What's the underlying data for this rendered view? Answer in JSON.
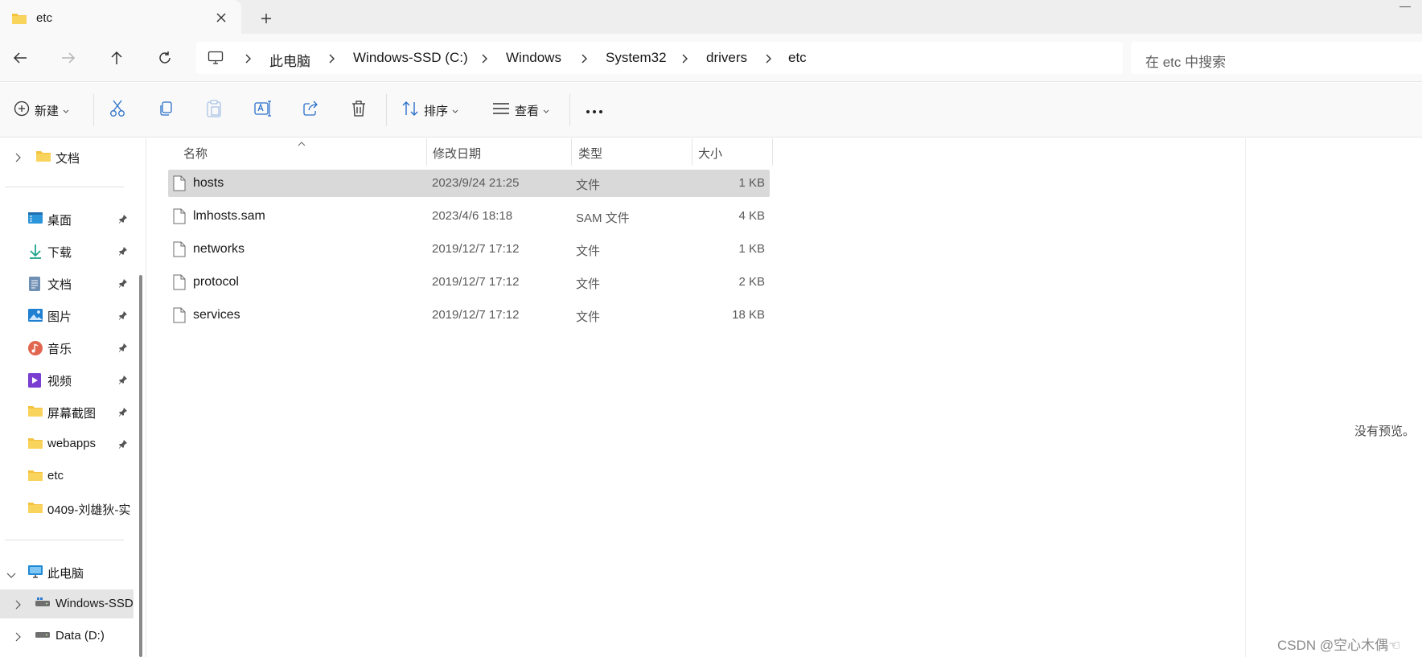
{
  "window": {
    "tab_title": "etc",
    "new_tab_symbol": "+"
  },
  "breadcrumb": [
    "此电脑",
    "Windows-SSD (C:)",
    "Windows",
    "System32",
    "drivers",
    "etc"
  ],
  "search": {
    "placeholder": "在 etc 中搜索"
  },
  "toolbar": {
    "new_label": "新建",
    "sort_label": "排序",
    "view_label": "查看",
    "more_label": "···"
  },
  "sidebar": {
    "top_item": {
      "label": "文档",
      "icon": "folder-icon"
    },
    "quick_access": [
      {
        "label": "桌面",
        "icon": "desktop-icon",
        "pinned": true
      },
      {
        "label": "下载",
        "icon": "download-icon",
        "pinned": true
      },
      {
        "label": "文档",
        "icon": "document-icon",
        "pinned": true
      },
      {
        "label": "图片",
        "icon": "pictures-icon",
        "pinned": true
      },
      {
        "label": "音乐",
        "icon": "music-icon",
        "pinned": true
      },
      {
        "label": "视频",
        "icon": "video-icon",
        "pinned": true
      },
      {
        "label": "屏幕截图",
        "icon": "folder-icon",
        "pinned": true
      },
      {
        "label": "webapps",
        "icon": "folder-icon",
        "pinned": true
      },
      {
        "label": "etc",
        "icon": "folder-icon",
        "pinned": false
      },
      {
        "label": "0409-刘雄狄-实",
        "icon": "folder-icon",
        "pinned": false
      }
    ],
    "this_pc": {
      "label": "此电脑",
      "icon": "computer-icon"
    },
    "drives": [
      {
        "label": "Windows-SSD",
        "icon": "drive-icon",
        "selected": true
      },
      {
        "label": "Data (D:)",
        "icon": "drive-icon",
        "selected": false
      }
    ]
  },
  "columns": {
    "name": "名称",
    "date": "修改日期",
    "type": "类型",
    "size": "大小"
  },
  "files": [
    {
      "name": "hosts",
      "date": "2023/9/24 21:25",
      "type": "文件",
      "size": "1 KB",
      "selected": true
    },
    {
      "name": "lmhosts.sam",
      "date": "2023/4/6 18:18",
      "type": "SAM 文件",
      "size": "4 KB",
      "selected": false
    },
    {
      "name": "networks",
      "date": "2019/12/7 17:12",
      "type": "文件",
      "size": "1 KB",
      "selected": false
    },
    {
      "name": "protocol",
      "date": "2019/12/7 17:12",
      "type": "文件",
      "size": "2 KB",
      "selected": false
    },
    {
      "name": "services",
      "date": "2019/12/7 17:12",
      "type": "文件",
      "size": "18 KB",
      "selected": false
    }
  ],
  "preview": {
    "empty_text": "没有预览。"
  },
  "watermark": "CSDN @空心木偶☜"
}
